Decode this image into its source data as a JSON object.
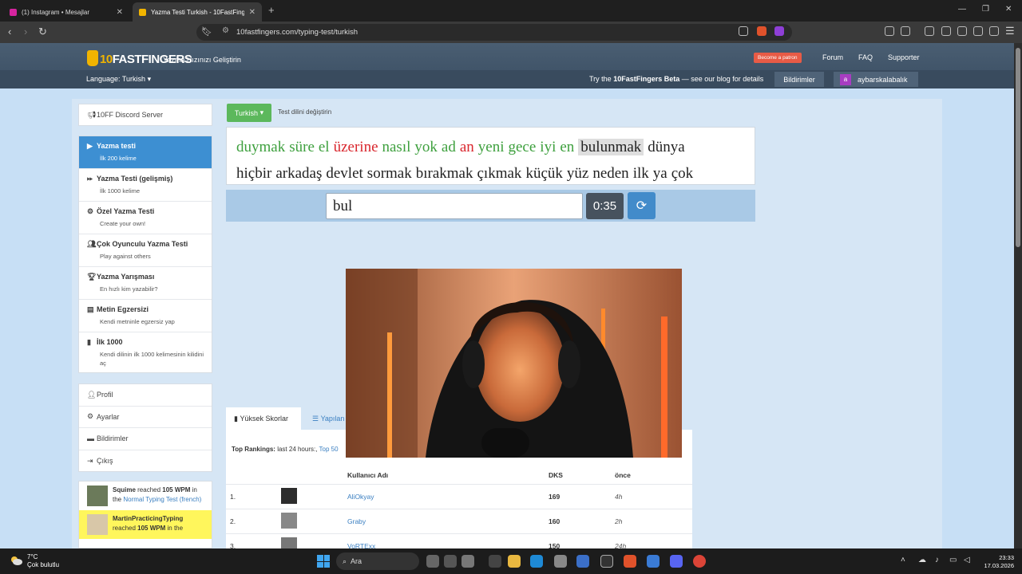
{
  "browser": {
    "tabs": [
      {
        "title": "(1) Instagram • Mesajlar"
      },
      {
        "title": "Yazma Testi Turkish - 10FastFing..."
      }
    ],
    "url": "10fastfingers.com/typing-test/turkish"
  },
  "header": {
    "logo_ten": "10",
    "logo_text": "FASTFINGERS",
    "tagline": "Yazma Hızınızı Geliştirin",
    "patron": "Become a patron",
    "links": [
      "Forum",
      "FAQ",
      "Supporter"
    ],
    "language": "Language: Turkish",
    "beta_prefix": "Try the ",
    "beta_bold": "10FastFingers Beta",
    "beta_suffix": " — see our blog for details",
    "notifications": "Bildirimler",
    "avatar_letter": "a",
    "username": "aybarskalabalık"
  },
  "sidebar": {
    "discord": "10FF Discord Server",
    "items": [
      {
        "title": "Yazma testi",
        "sub": "İlk 200 kelime"
      },
      {
        "title": "Yazma Testi (gelişmiş)",
        "sub": "İlk 1000 kelime"
      },
      {
        "title": "Özel Yazma Testi",
        "sub": "Create your own!"
      },
      {
        "title": "Çok Oyunculu Yazma Testi",
        "sub": "Play against others"
      },
      {
        "title": "Yazma Yarışması",
        "sub": "En hızlı kim yazabilir?"
      },
      {
        "title": "Metin Egzersizi",
        "sub": "Kendi metninle egzersiz yap"
      },
      {
        "title": "İlk 1000",
        "sub": "Kendi dilinin ilk 1000 kelimesinin kilidini aç"
      }
    ],
    "account": [
      "Profil",
      "Ayarlar",
      "Bildirimler",
      "Çıkış"
    ],
    "feed": [
      {
        "user": "Squime",
        "mid": " reached ",
        "wpm": "105 WPM",
        "in": " in the ",
        "test": "Normal Typing Test",
        "lang": " (french)"
      },
      {
        "user": "MartinPracticingTyping",
        "mid": " reached ",
        "wpm": "105 WPM",
        "in": " in the",
        "test": "",
        "lang": ""
      }
    ]
  },
  "test": {
    "language_button": "Turkish",
    "language_hint": "Test dilini değiştirin",
    "line1": [
      {
        "w": "duymak",
        "s": "ok"
      },
      {
        "w": "süre",
        "s": "ok"
      },
      {
        "w": "el",
        "s": "ok"
      },
      {
        "w": "üzerine",
        "s": "bad"
      },
      {
        "w": "nasıl",
        "s": "ok"
      },
      {
        "w": "yok",
        "s": "ok"
      },
      {
        "w": "ad",
        "s": "ok"
      },
      {
        "w": "an",
        "s": "bad"
      },
      {
        "w": "yeni",
        "s": "ok"
      },
      {
        "w": "gece",
        "s": "ok"
      },
      {
        "w": "iyi",
        "s": "ok"
      },
      {
        "w": "en",
        "s": "ok"
      },
      {
        "w": "bulunmak",
        "s": "cur"
      },
      {
        "w": "dünya",
        "s": ""
      }
    ],
    "line2": [
      "hiçbir",
      "arkadaş",
      "devlet",
      "sormak",
      "bırakmak",
      "çıkmak",
      "küçük",
      "yüz",
      "neden",
      "ilk",
      "ya",
      "çok"
    ],
    "input_value": "bul",
    "timer": "0:35",
    "accent": "#3d8fd2",
    "correct_color": "#3ea03e",
    "wrong_color": "#d9262d"
  },
  "scores": {
    "tab_high": "Yüksek Skorlar",
    "tab_other": "Yapılan",
    "rankings_label": "Top Rankings:",
    "rankings_value": " last 24 hours:, ",
    "rankings_link": "Top 50",
    "columns": [
      "Kullanıcı Adı",
      "DKS",
      "önce"
    ],
    "rows": [
      {
        "rank": "1.",
        "name": "AliOkyay",
        "dks": "169",
        "ago": "4h"
      },
      {
        "rank": "2.",
        "name": "Graby",
        "dks": "160",
        "ago": "2h"
      },
      {
        "rank": "3.",
        "name": "VoRTExx",
        "dks": "150",
        "ago": "24h"
      }
    ]
  },
  "taskbar": {
    "temp": "7°C",
    "weather": "Çok bulutlu",
    "search": "Ara",
    "time": "23:33",
    "date": "17.03.2026"
  }
}
